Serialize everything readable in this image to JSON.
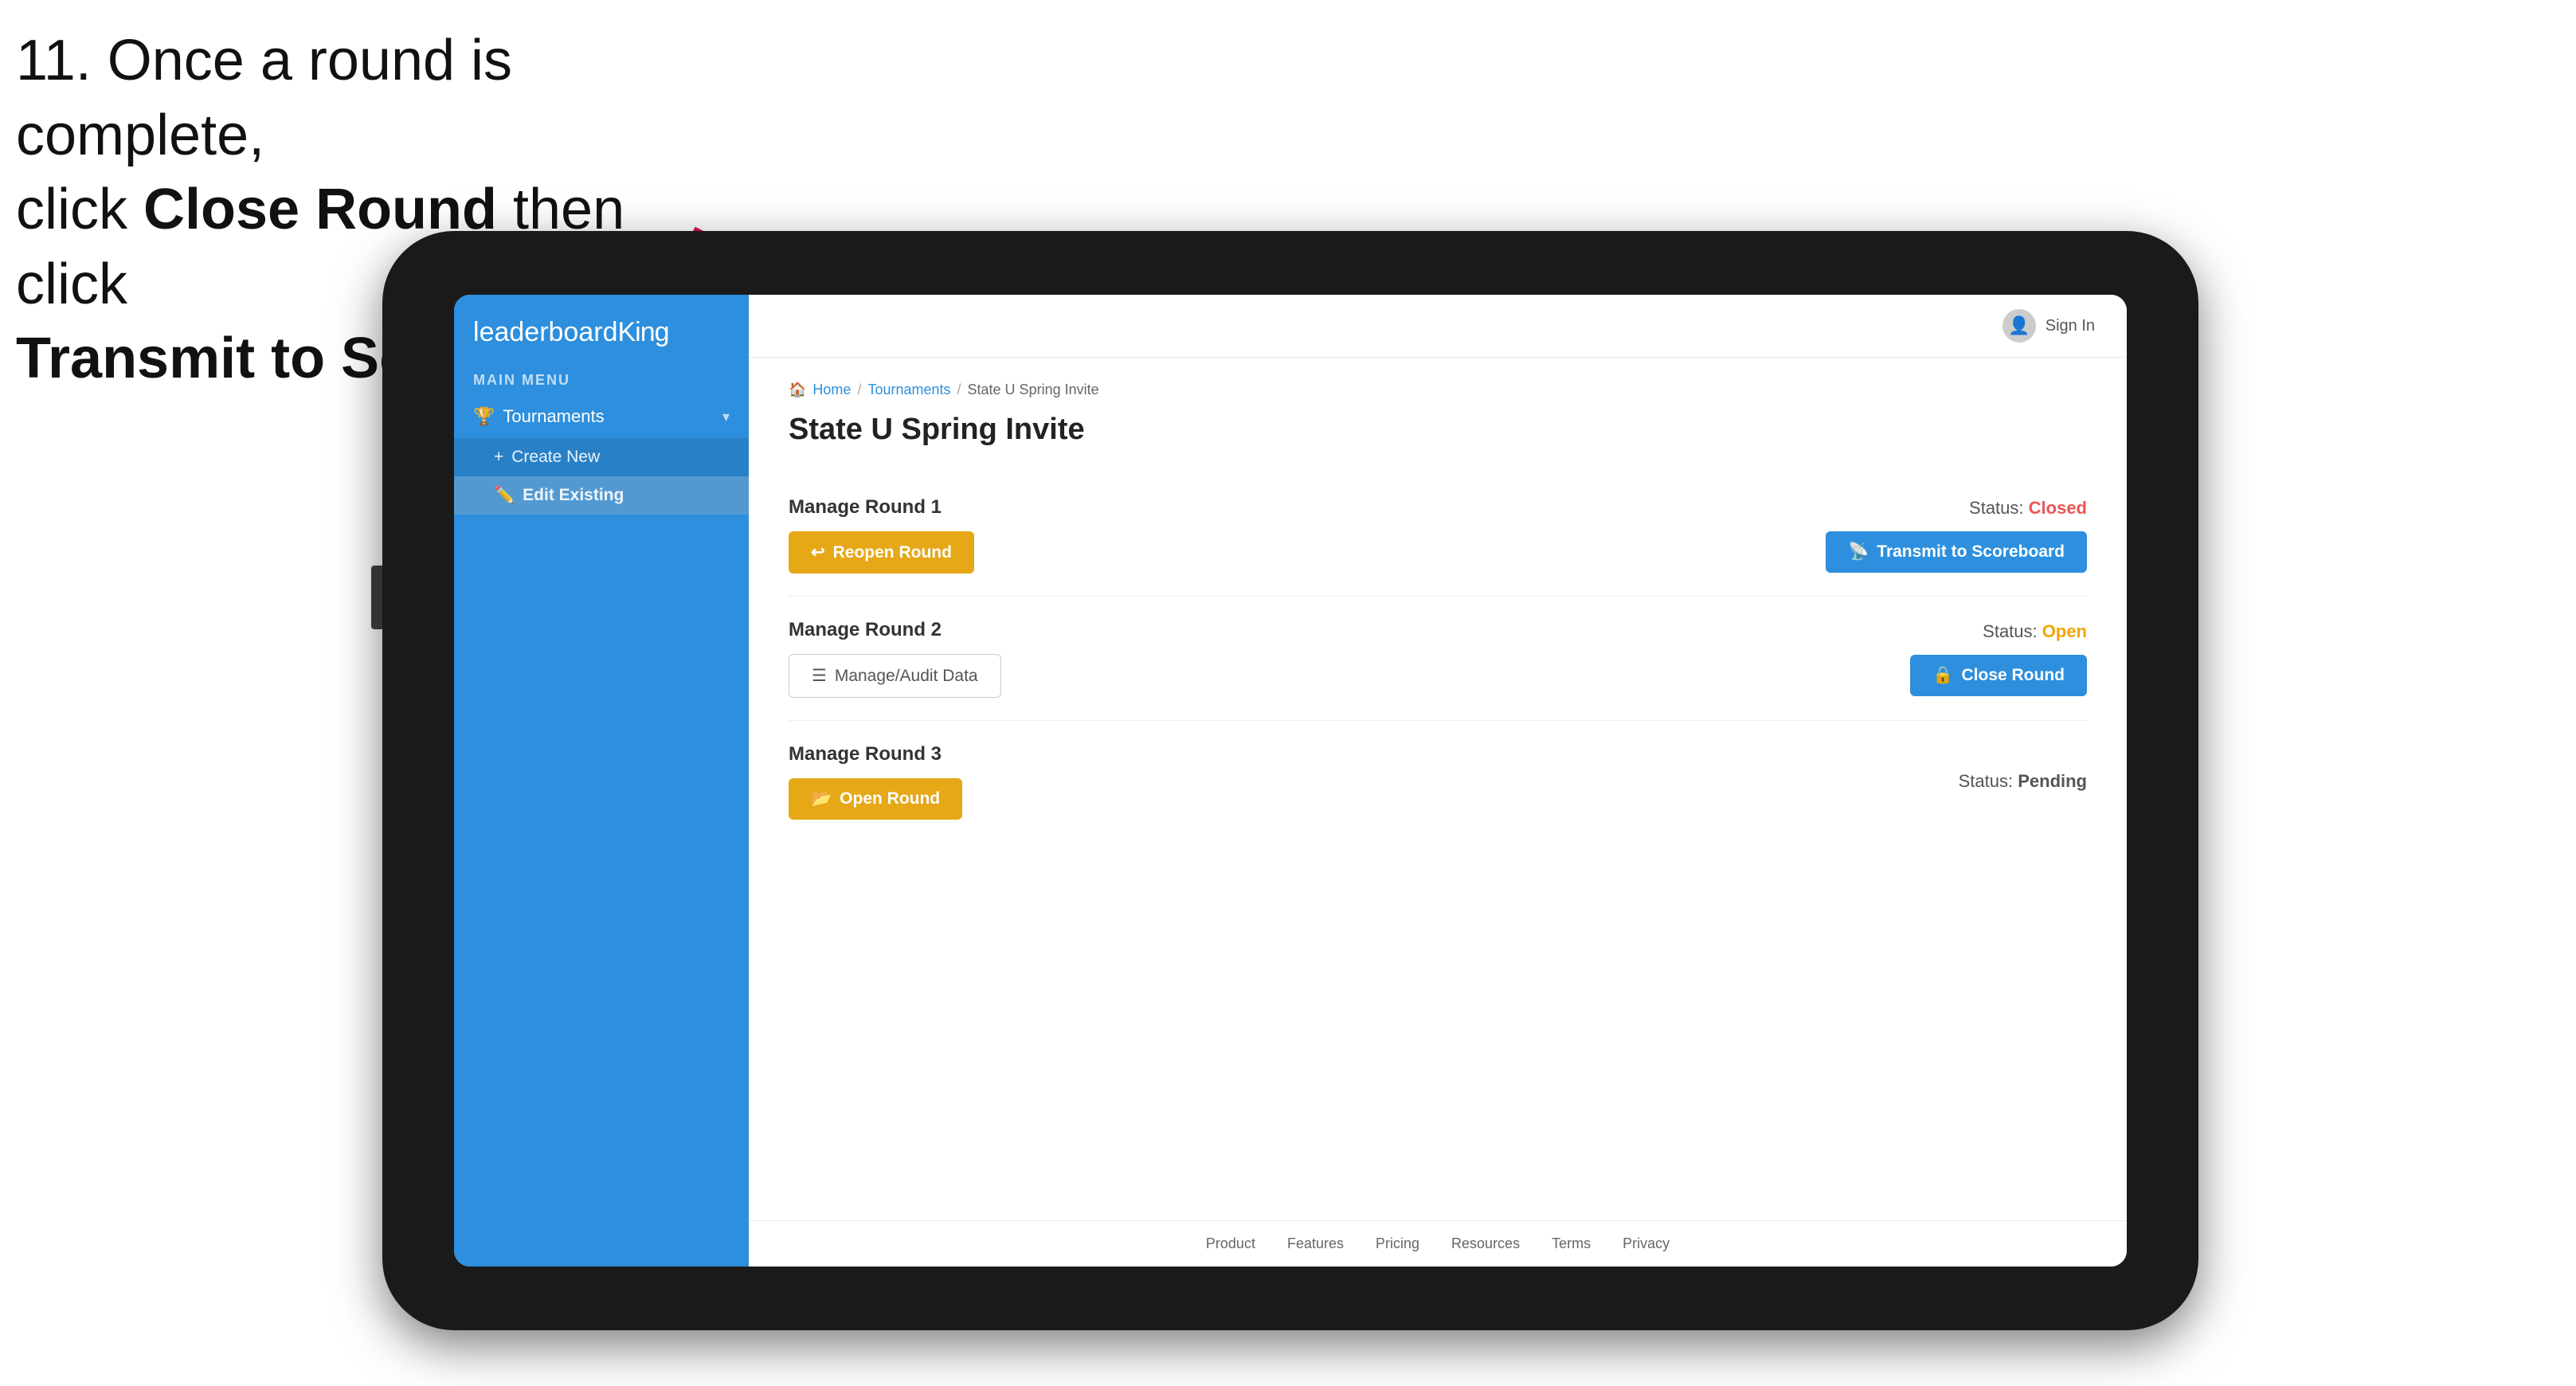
{
  "instruction": {
    "line1": "11. Once a round is complete,",
    "line2_prefix": "click ",
    "line2_bold": "Close Round",
    "line2_suffix": " then click",
    "line3": "Transmit to Scoreboard."
  },
  "app": {
    "logo": {
      "prefix": "leaderboard",
      "suffix": "King"
    },
    "main_menu_label": "MAIN MENU",
    "sidebar": {
      "items": [
        {
          "label": "Tournaments",
          "icon": "🏆",
          "expanded": true,
          "subitems": [
            {
              "label": "Create New",
              "icon": "+"
            },
            {
              "label": "Edit Existing",
              "icon": "✏️",
              "active": true
            }
          ]
        }
      ]
    },
    "topbar": {
      "sign_in_label": "Sign In"
    },
    "breadcrumb": {
      "home": "Home",
      "sep1": "/",
      "tournaments": "Tournaments",
      "sep2": "/",
      "current": "State U Spring Invite"
    },
    "page_title": "State U Spring Invite",
    "rounds": [
      {
        "id": "round1",
        "title": "Manage Round 1",
        "status_label": "Status:",
        "status_value": "Closed",
        "status_class": "status-closed",
        "buttons": [
          {
            "label": "Reopen Round",
            "type": "amber",
            "icon": "↩"
          },
          {
            "label": "Transmit to Scoreboard",
            "type": "blue",
            "icon": "📡"
          }
        ]
      },
      {
        "id": "round2",
        "title": "Manage Round 2",
        "status_label": "Status:",
        "status_value": "Open",
        "status_class": "status-open",
        "buttons": [
          {
            "label": "Manage/Audit Data",
            "type": "outline-gray",
            "icon": "☰"
          },
          {
            "label": "Close Round",
            "type": "blue",
            "icon": "🔒"
          }
        ]
      },
      {
        "id": "round3",
        "title": "Manage Round 3",
        "status_label": "Status:",
        "status_value": "Pending",
        "status_class": "status-pending",
        "buttons": [
          {
            "label": "Open Round",
            "type": "amber",
            "icon": "📂"
          }
        ]
      }
    ],
    "footer": {
      "links": [
        "Product",
        "Features",
        "Pricing",
        "Resources",
        "Terms",
        "Privacy"
      ]
    }
  }
}
